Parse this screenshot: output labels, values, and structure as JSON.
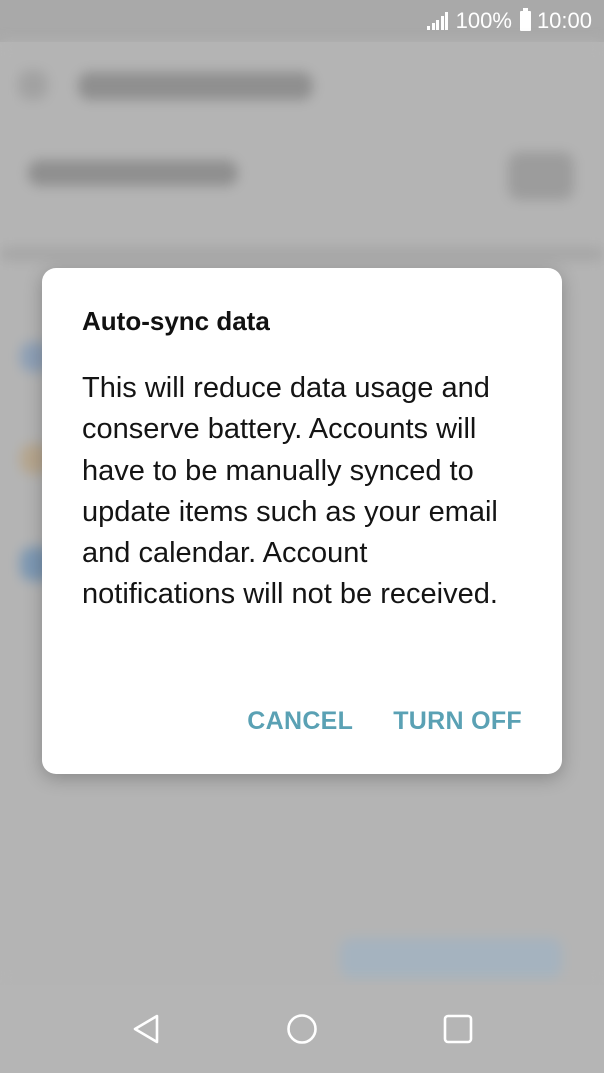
{
  "status_bar": {
    "battery": "100%",
    "time": "10:00"
  },
  "dialog": {
    "title": "Auto-sync data",
    "message": "This will reduce data usage and conserve battery. Accounts will have to be manually synced to update items such as your email and calendar. Account notifications will not be received.",
    "cancel_label": "CANCEL",
    "confirm_label": "TURN OFF",
    "accent_color": "#5aa1b4"
  },
  "nav_bar": {
    "icons": [
      "back-icon",
      "home-icon",
      "recents-icon"
    ]
  }
}
